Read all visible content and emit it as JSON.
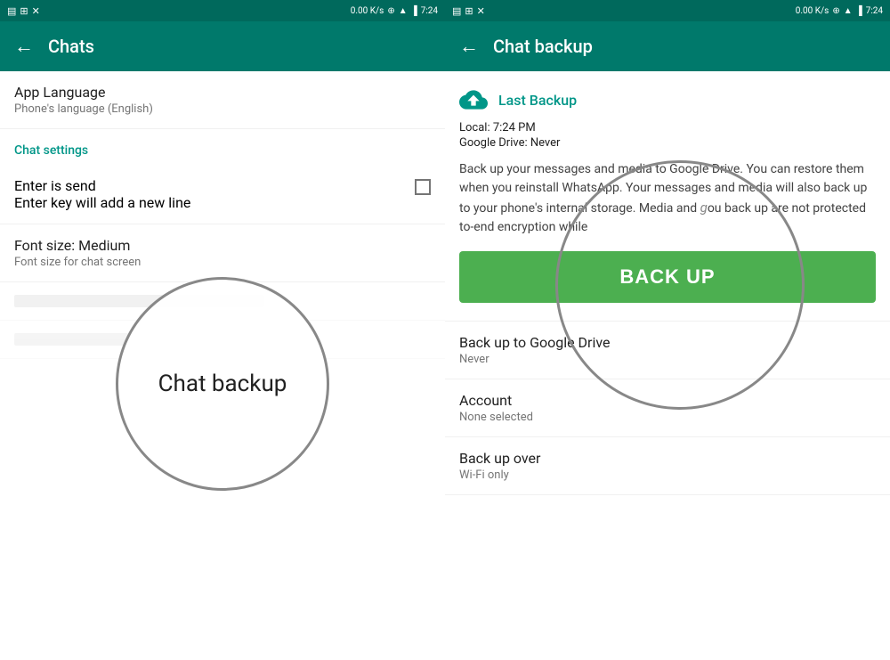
{
  "left_panel": {
    "status_bar": {
      "left_icons": "▤ 🖼 ✕",
      "speed": "0.00 K/s",
      "right_icons": "⊕ ▼ ▲ 📶 🔋",
      "time": "7:24"
    },
    "app_bar": {
      "back_label": "←",
      "title": "Chats"
    },
    "items": [
      {
        "title": "App Language",
        "subtitle": "Phone's language (English)"
      }
    ],
    "section_header": "Chat settings",
    "settings_items": [
      {
        "title": "Enter is send",
        "subtitle": "Enter key will add a new line",
        "has_checkbox": true
      },
      {
        "title": "Font size: Medium",
        "subtitle": "Font size for chat screen",
        "has_checkbox": false
      }
    ],
    "circle_label": "Chat backup"
  },
  "right_panel": {
    "status_bar": {
      "left_icons": "▤ 🖼 ✕",
      "speed": "0.00 K/s",
      "right_icons": "⊕ ▼ ▲ 📶 🔋",
      "time": "7:24"
    },
    "app_bar": {
      "back_label": "←",
      "title": "Chat backup"
    },
    "last_backup_label": "Last Backup",
    "local_backup": "Local: 7:24 PM",
    "drive_backup": "Google Drive: Never",
    "description": "Back up your messages and media to Google Drive. You can restore them when you reinstall WhatsApp. Your messages and media will also back up to your phone's internal storage. Media and",
    "description2": "ou back up are not protected",
    "description3": "to-end encryption while",
    "back_up_button": "BACK UP",
    "backup_options": [
      {
        "title": "Back up to Google Drive",
        "subtitle": "Never"
      },
      {
        "title": "Account",
        "subtitle": "None selected"
      },
      {
        "title": "Back up over",
        "subtitle": "Wi-Fi only"
      }
    ]
  }
}
